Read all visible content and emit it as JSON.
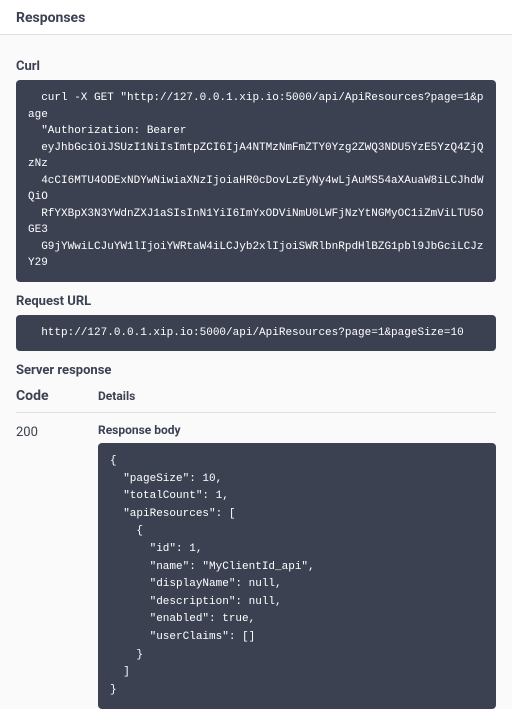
{
  "section": {
    "title": "Responses"
  },
  "curl": {
    "label": "Curl",
    "content": "  curl -X GET \"http://127.0.0.1.xip.io:5000/api/ApiResources?page=1&page\n  \"Authorization: Bearer\n  eyJhbGciOiJSUzI1NiIsImtpZCI6IjA4NTMzNmFmZTY0Yzg2ZWQ3NDU5YzE5YzQ4ZjQzNz\n  4cCI6MTU4ODExNDYwNiwiaXNzIjoiaHR0cDovLzEyNy4wLjAuMS54aXAuaW8iLCJhdWQiO\n  RfYXBpX3N3YWdnZXJ1aSIsInN1YiI6ImYxODViNmU0LWFjNzYtNGMyOC1iZmViLTU5OGE3\n  G9jYWwiLCJuYW1lIjoiYWRtaW4iLCJyb2xlIjoiSWRlbnRpdHlBZG1pbl9JbGciLCJzY29"
  },
  "requestUrl": {
    "label": "Request URL",
    "content": "  http://127.0.0.1.xip.io:5000/api/ApiResources?page=1&pageSize=10"
  },
  "serverResponse": {
    "label": "Server response",
    "headers": {
      "code": "Code",
      "details": "Details"
    },
    "row": {
      "code": "200",
      "bodyLabel": "Response body",
      "body": "{\n  \"pageSize\": 10,\n  \"totalCount\": 1,\n  \"apiResources\": [\n    {\n      \"id\": 1,\n      \"name\": \"MyClientId_api\",\n      \"displayName\": null,\n      \"description\": null,\n      \"enabled\": true,\n      \"userClaims\": []\n    }\n  ]\n}"
    }
  }
}
